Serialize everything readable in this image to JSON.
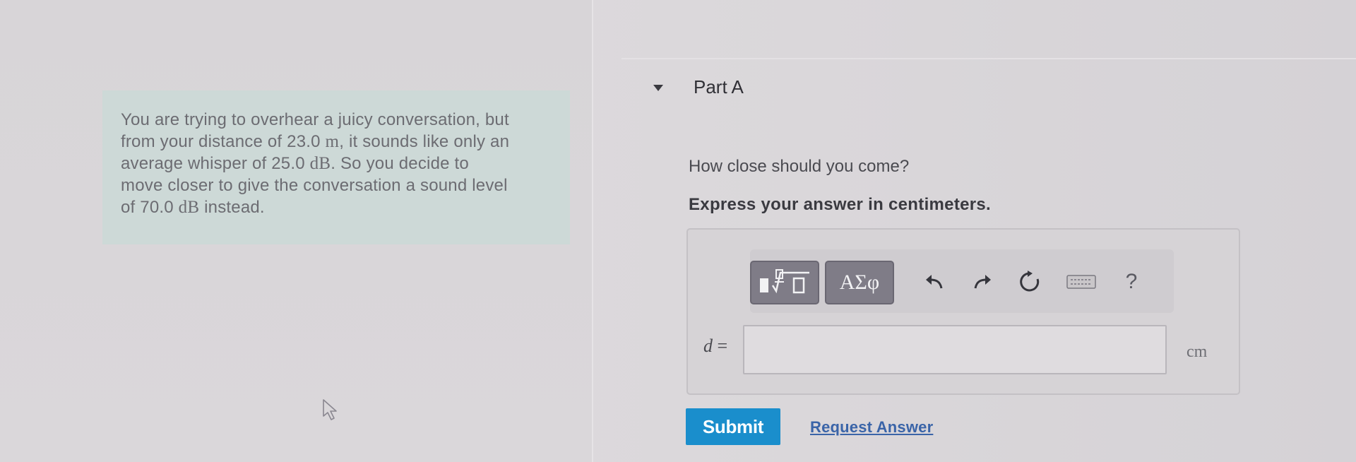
{
  "intro": {
    "line1": "You are trying to overhear a juicy conversation, but",
    "line2_before": "from your distance of 23.0 ",
    "line2_unit": "m",
    "line2_after": ", it sounds like only an",
    "line3_before": "average whisper of 25.0 ",
    "line3_unit": "dB",
    "line3_after": ". So you decide to",
    "line4": "move closer to give the conversation a sound level",
    "line5_before": "of 70.0 ",
    "line5_unit": "dB",
    "line5_after": " instead."
  },
  "part": {
    "title": "Part A",
    "question": "How close should you come?",
    "instruction": "Express your answer in centimeters."
  },
  "toolbar": {
    "template_icon": "fraction-root-template-icon",
    "symbols_label": "ΑΣφ",
    "undo_icon": "undo-icon",
    "redo_icon": "redo-icon",
    "reset_icon": "reset-icon",
    "keyboard_icon": "keyboard-icon",
    "help_label": "?"
  },
  "answer": {
    "variable": "d",
    "equals": "=",
    "value": "",
    "unit": "cm"
  },
  "actions": {
    "submit_label": "Submit",
    "request_label": "Request Answer"
  },
  "colors": {
    "submit_bg": "#1a8ecc",
    "intro_bg": "#cdd9d7",
    "link": "#3a64a8"
  }
}
